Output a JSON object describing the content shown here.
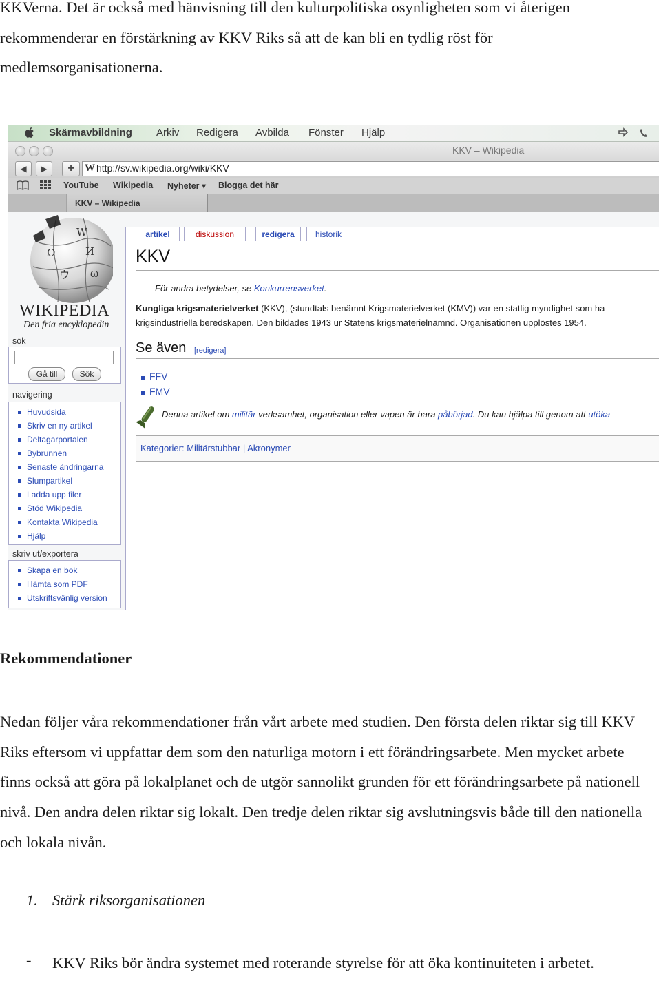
{
  "doc": {
    "top_paragraph": "KKVerna. Det är också med hänvisning till den kulturpolitiska osynligheten som vi återigen rekommenderar en förstärkning av KKV Riks så att de kan bli en tydlig röst för medlemsorganisationerna.",
    "heading": "Rekommendationer",
    "main_paragraph": "Nedan följer våra rekommendationer från vårt arbete med studien. Den första delen riktar sig till KKV Riks eftersom vi uppfattar dem som den naturliga motorn i ett förändringsarbete. Men mycket arbete finns också att göra på lokalplanet och de utgör sannolikt grunden för ett förändringsarbete på nationell nivå. Den andra delen riktar sig lokalt. Den tredje delen riktar sig avslutningsvis både till den nationella och lokala nivån.",
    "subheading_number": "1.",
    "subheading": "Stärk riksorganisationen",
    "bullet_dash": "-",
    "bullet_text": "KKV Riks bör ändra systemet med roterande styrelse för att öka kontinuiteten i arbetet."
  },
  "screenshot": {
    "menubar": [
      "Skärmavbildning",
      "Arkiv",
      "Redigera",
      "Avbilda",
      "Fönster",
      "Hjälp"
    ],
    "window_title": "KKV – Wikipedia",
    "nav_back": "◀",
    "nav_forward": "▶",
    "nav_add": "+",
    "url_prefix": "W",
    "url": "http://sv.wikipedia.org/wiki/KKV",
    "bookmarks": [
      "YouTube",
      "Wikipedia",
      "Nyheter ▾",
      "Blogga det här"
    ],
    "tab_title": "KKV – Wikipedia",
    "wordmark": "WIKIPEDIA",
    "tagline": "Den fria encyklopedin",
    "search_heading": "sök",
    "search_go": "Gå till",
    "search_find": "Sök",
    "nav_heading": "navigering",
    "nav_items": [
      "Huvudsida",
      "Skriv en ny artikel",
      "Deltagarportalen",
      "Bybrunnen",
      "Senaste ändringarna",
      "Slumpartikel",
      "Ladda upp filer",
      "Stöd Wikipedia",
      "Kontakta Wikipedia",
      "Hjälp"
    ],
    "export_heading": "skriv ut/exportera",
    "export_items": [
      "Skapa en bok",
      "Hämta som PDF",
      "Utskriftsvänlig version"
    ],
    "tabs": [
      "artikel",
      "diskussion",
      "redigera",
      "historik"
    ],
    "article_title": "KKV",
    "hatnote_prefix": "För andra betydelser, se ",
    "hatnote_link": "Konkurrensverket",
    "hatnote_suffix": ".",
    "body_bold": "Kungliga krigsmaterielverket",
    "body_line1_rest": " (KKV), (stundtals benämnt Krigsmaterielverket (KMV)) var en statlig myndighet som ha",
    "body_line2": "krigsindustriella beredskapen. Den bildades 1943 ur Statens krigsmaterielnämnd. Organisationen upplöstes 1954.",
    "see_also": "Se även",
    "see_also_edit": "[redigera]",
    "see_also_items": [
      "FFV",
      "FMV"
    ],
    "stub_part1": "Denna artikel om ",
    "stub_link1": "militär",
    "stub_part2": " verksamhet, organisation eller vapen är bara ",
    "stub_link2": "påbörjad",
    "stub_part3": ". Du kan hjälpa till genom att ",
    "stub_link3": "utöka",
    "categories": "Kategorier: Militärstubbar | Akronymer"
  }
}
